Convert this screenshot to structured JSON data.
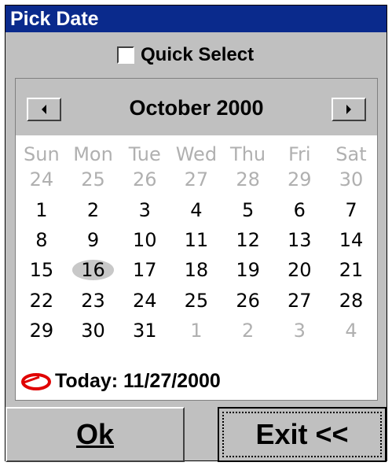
{
  "window": {
    "title": "Pick Date"
  },
  "quick_select": {
    "label": "Quick Select",
    "checked": false
  },
  "calendar": {
    "month_title": "October 2000",
    "weekdays": [
      "Sun",
      "Mon",
      "Tue",
      "Wed",
      "Thu",
      "Fri",
      "Sat"
    ],
    "weeks": [
      [
        {
          "d": "24",
          "other": true
        },
        {
          "d": "25",
          "other": true
        },
        {
          "d": "26",
          "other": true
        },
        {
          "d": "27",
          "other": true
        },
        {
          "d": "28",
          "other": true
        },
        {
          "d": "29",
          "other": true
        },
        {
          "d": "30",
          "other": true
        }
      ],
      [
        {
          "d": "1"
        },
        {
          "d": "2"
        },
        {
          "d": "3"
        },
        {
          "d": "4"
        },
        {
          "d": "5"
        },
        {
          "d": "6"
        },
        {
          "d": "7"
        }
      ],
      [
        {
          "d": "8"
        },
        {
          "d": "9"
        },
        {
          "d": "10"
        },
        {
          "d": "11"
        },
        {
          "d": "12"
        },
        {
          "d": "13"
        },
        {
          "d": "14"
        }
      ],
      [
        {
          "d": "15"
        },
        {
          "d": "16",
          "selected": true
        },
        {
          "d": "17"
        },
        {
          "d": "18"
        },
        {
          "d": "19"
        },
        {
          "d": "20"
        },
        {
          "d": "21"
        }
      ],
      [
        {
          "d": "22"
        },
        {
          "d": "23"
        },
        {
          "d": "24"
        },
        {
          "d": "25"
        },
        {
          "d": "26"
        },
        {
          "d": "27"
        },
        {
          "d": "28"
        }
      ],
      [
        {
          "d": "29"
        },
        {
          "d": "30"
        },
        {
          "d": "31"
        },
        {
          "d": "1",
          "other": true
        },
        {
          "d": "2",
          "other": true
        },
        {
          "d": "3",
          "other": true
        },
        {
          "d": "4",
          "other": true
        }
      ]
    ],
    "today_label": "Today: 11/27/2000"
  },
  "buttons": {
    "ok_label": "Ok",
    "exit_label": "Exit <<"
  },
  "colors": {
    "titlebar": "#0a2a8c",
    "today_marker": "#e00000",
    "selected_day": "#c8c8c8"
  }
}
